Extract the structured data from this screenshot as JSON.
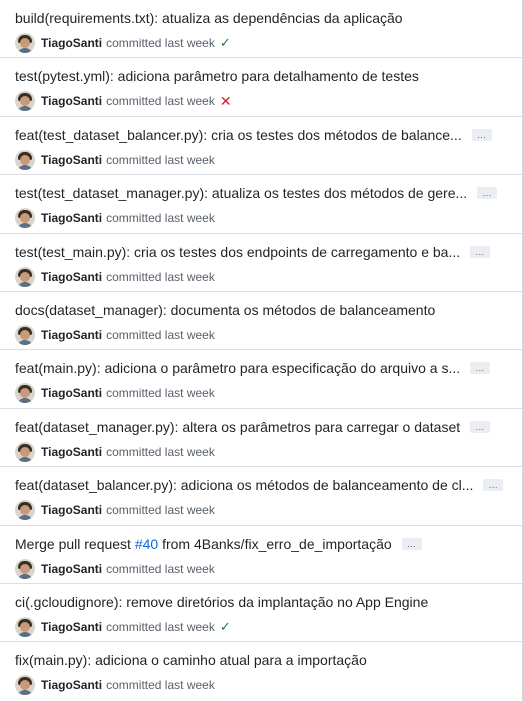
{
  "commits": [
    {
      "title": "build(requirements.txt): atualiza as dependências da aplicação",
      "author": "TiagoSanti",
      "committed": "committed last week",
      "status": "success",
      "has_more": false
    },
    {
      "title": "test(pytest.yml): adiciona parâmetro para detalhamento de testes",
      "author": "TiagoSanti",
      "committed": "committed last week",
      "status": "failure",
      "has_more": false
    },
    {
      "title": "feat(test_dataset_balancer.py): cria os testes dos métodos de balance...",
      "author": "TiagoSanti",
      "committed": "committed last week",
      "status": "none",
      "has_more": true
    },
    {
      "title": "test(test_dataset_manager.py): atualiza os testes dos métodos de gere...",
      "author": "TiagoSanti",
      "committed": "committed last week",
      "status": "none",
      "has_more": true
    },
    {
      "title": "test(test_main.py): cria os testes dos endpoints de carregamento e ba...",
      "author": "TiagoSanti",
      "committed": "committed last week",
      "status": "none",
      "has_more": true
    },
    {
      "title": "docs(dataset_manager): documenta os métodos de balanceamento",
      "author": "TiagoSanti",
      "committed": "committed last week",
      "status": "none",
      "has_more": false
    },
    {
      "title": "feat(main.py): adiciona o parâmetro para especificação do arquivo a s...",
      "author": "TiagoSanti",
      "committed": "committed last week",
      "status": "none",
      "has_more": true
    },
    {
      "title": "feat(dataset_manager.py): altera os parâmetros para carregar o dataset",
      "author": "TiagoSanti",
      "committed": "committed last week",
      "status": "none",
      "has_more": true
    },
    {
      "title": "feat(dataset_balancer.py): adiciona os métodos de balanceamento de cl...",
      "author": "TiagoSanti",
      "committed": "committed last week",
      "status": "none",
      "has_more": true
    },
    {
      "title_prefix": "Merge pull request ",
      "pr_link": "#40",
      "title_suffix": " from 4Banks/fix_erro_de_importação",
      "author": "TiagoSanti",
      "committed": "committed last week",
      "status": "none",
      "has_more": true
    },
    {
      "title": "ci(.gcloudignore): remove diretórios da implantação no App Engine",
      "author": "TiagoSanti",
      "committed": "committed last week",
      "status": "success",
      "has_more": false
    },
    {
      "title": "fix(main.py): adiciona o caminho atual para a importação",
      "author": "TiagoSanti",
      "committed": "committed last week",
      "status": "none",
      "has_more": false
    }
  ],
  "ellipsis_label": "...",
  "status_icons": {
    "success": "check-icon",
    "failure": "x-icon"
  },
  "colors": {
    "success": "#1a7f37",
    "failure": "#cf222e",
    "link": "#0969da"
  }
}
